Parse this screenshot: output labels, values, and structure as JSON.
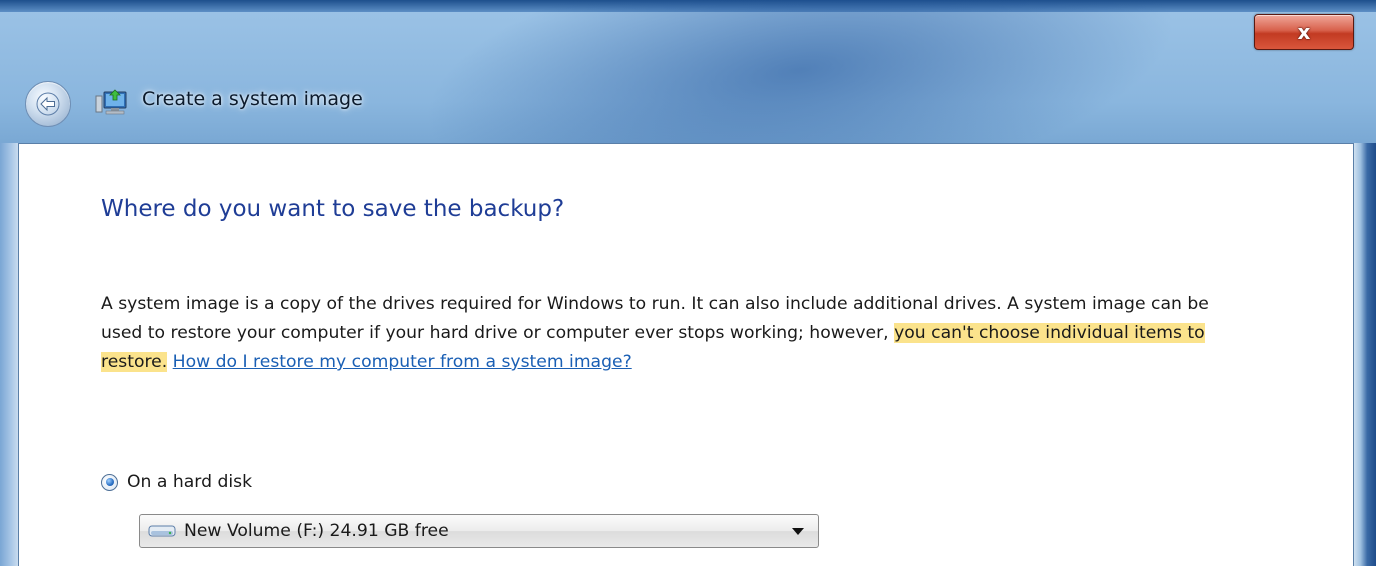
{
  "window": {
    "title": "Create a system image",
    "close_label": "x"
  },
  "icons": {
    "back": "back-arrow-icon",
    "title": "system-image-icon",
    "close": "close-icon",
    "drive": "hard-drive-icon",
    "dropdown": "chevron-down-icon"
  },
  "page": {
    "heading": "Where do you want to save the backup?",
    "description_part1": "A system image is a copy of the drives required for Windows to run. It can also include additional drives. A system image can be used to restore your computer if your hard drive or computer ever stops working; however, ",
    "description_highlight": "you can't choose individual items to restore.",
    "help_link": "How do I restore my computer from a system image?",
    "radio_hard_disk_label": "On a hard disk",
    "radio_hard_disk_selected": true,
    "drive_selected": "New Volume (F:)  24.91 GB free"
  },
  "colors": {
    "heading": "#1f3d96",
    "link": "#1a5fb4",
    "highlight": "#fbe38c",
    "close_button": "#c23a22"
  }
}
